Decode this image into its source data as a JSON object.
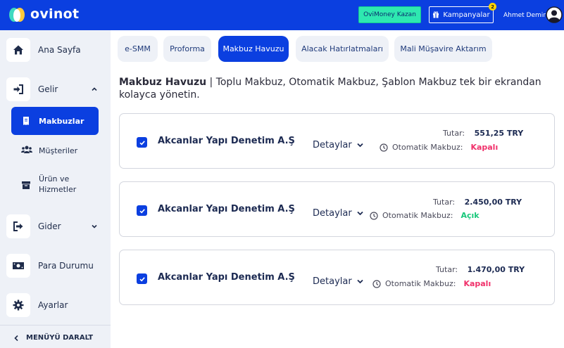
{
  "header": {
    "logo_text": "ovinot",
    "money_button": "OviMoney Kazan",
    "campaigns_button": "Kampanyalar",
    "campaigns_badge": "2",
    "user_name": "Ahmet Demir",
    "accent": "#0b3fe0"
  },
  "sidebar": {
    "home": "Ana Sayfa",
    "income": "Gelir",
    "receipts": "Makbuzlar",
    "customers": "Müşteriler",
    "products_line1": "Ürün ve",
    "products_line2": "Hizmetler",
    "expense": "Gider",
    "cash": "Para Durumu",
    "settings": "Ayarlar",
    "collapse": "MENÜYÜ DARALT"
  },
  "tabs": [
    {
      "label": "e-SMM",
      "active": false
    },
    {
      "label": "Proforma",
      "active": false
    },
    {
      "label": "Makbuz Havuzu",
      "active": true
    },
    {
      "label": "Alacak Hatırlatmaları",
      "active": false
    },
    {
      "label": "Mali Müşavire Aktarım",
      "active": false
    }
  ],
  "intro": {
    "title": "Makbuz Havuzu",
    "text": " | Toplu Makbuz, Otomatik Makbuz, Şablon Makbuz tek bir ekrandan kolayca yönetin."
  },
  "cards": [
    {
      "company": "Akcanlar Yapı Denetim A.Ş",
      "details": "Detaylar",
      "amount_label": "Tutar:",
      "amount": "551,25 TRY",
      "auto_label": "Otomatik Makbuz:",
      "status": "Kapalı",
      "status_color": "#f0306a",
      "checked": true
    },
    {
      "company": "Akcanlar Yapı Denetim A.Ş",
      "details": "Detaylar",
      "amount_label": "Tutar:",
      "amount": "2.450,00 TRY",
      "auto_label": "Otomatik Makbuz:",
      "status": "Açık",
      "status_color": "#17c77a",
      "checked": true
    },
    {
      "company": "Akcanlar Yapı Denetim A.Ş",
      "details": "Detaylar",
      "amount_label": "Tutar:",
      "amount": "1.470,00 TRY",
      "auto_label": "Otomatik Makbuz:",
      "status": "Kapalı",
      "status_color": "#f0306a",
      "checked": true
    }
  ]
}
